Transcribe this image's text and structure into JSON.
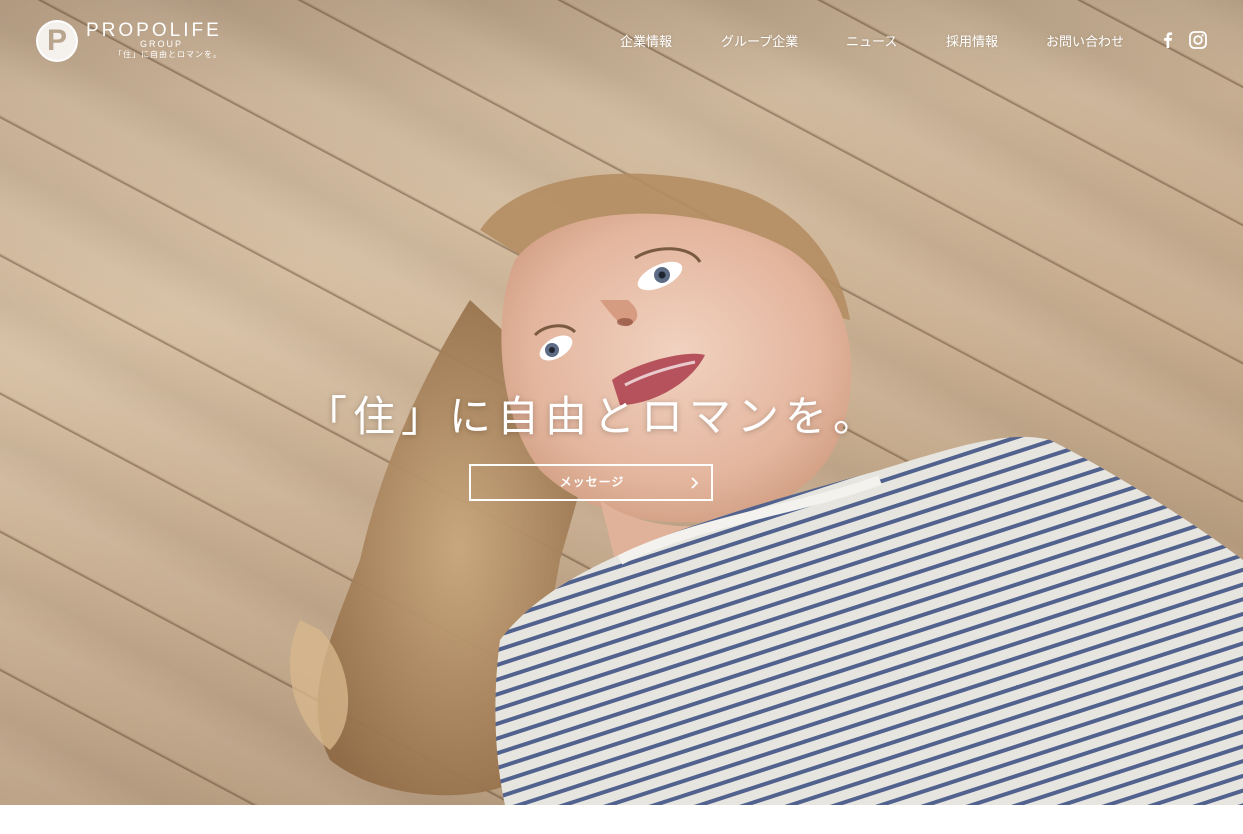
{
  "brand": {
    "mark": "P",
    "name": "PROPOLIFE",
    "group": "GROUP",
    "tagline": "「住」に自由とロマンを。"
  },
  "nav": {
    "items": [
      {
        "label": "企業情報"
      },
      {
        "label": "グループ企業"
      },
      {
        "label": "ニュース"
      },
      {
        "label": "採用情報"
      },
      {
        "label": "お問い合わせ"
      }
    ],
    "social": [
      {
        "icon": "facebook-icon"
      },
      {
        "icon": "instagram-icon"
      }
    ]
  },
  "hero": {
    "headline": "「住」に自由とロマンを。",
    "button_label": "メッセージ"
  },
  "colors": {
    "text": "#ffffff",
    "floor_wood": "#cdb59a",
    "shirt_stripe": "#4a5a86",
    "shirt_base": "#e8e6e1"
  }
}
